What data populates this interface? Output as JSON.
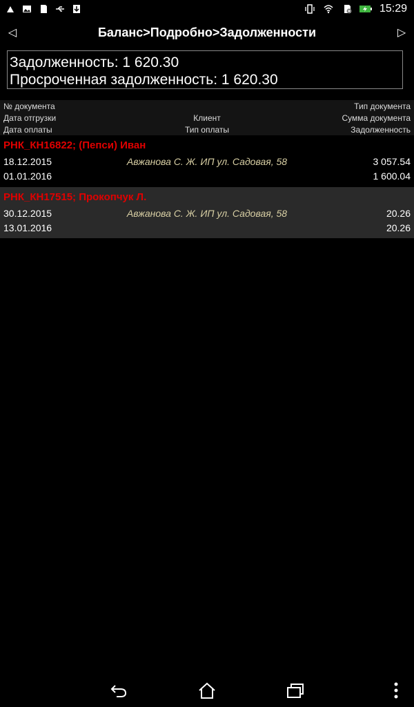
{
  "status": {
    "time": "15:29"
  },
  "header": {
    "title": "Баланс>Подробно>Задолженности"
  },
  "summary": {
    "debt": "Задолженность: 1 620.30",
    "overdue": "Просроченная задолженность: 1 620.30"
  },
  "columns": {
    "doc_no": "№ документа",
    "doc_type": "Тип документа",
    "ship_date": "Дата отгрузки",
    "client": "Клиент",
    "doc_sum": "Сумма документа",
    "pay_date": "Дата оплаты",
    "pay_type": "Тип оплаты",
    "debt": "Задолженность"
  },
  "documents": [
    {
      "name": "РНК_КН16822; (Пепси) Иван",
      "ship_date": "18.12.2015",
      "client": "Авжанова С. Ж. ИП ул. Садовая, 58",
      "sum": "3 057.54",
      "pay_date": "01.01.2016",
      "debt": "1 600.04"
    },
    {
      "name": "РНК_КН17515; Прокопчук Л.",
      "ship_date": "30.12.2015",
      "client": "Авжанова С. Ж. ИП ул. Садовая, 58",
      "sum": "20.26",
      "pay_date": "13.01.2016",
      "debt": "20.26"
    }
  ],
  "colors": {
    "accent_red": "#e00000",
    "client_text": "#d8cfa4",
    "row_alt_bg": "#2a2a2a"
  }
}
